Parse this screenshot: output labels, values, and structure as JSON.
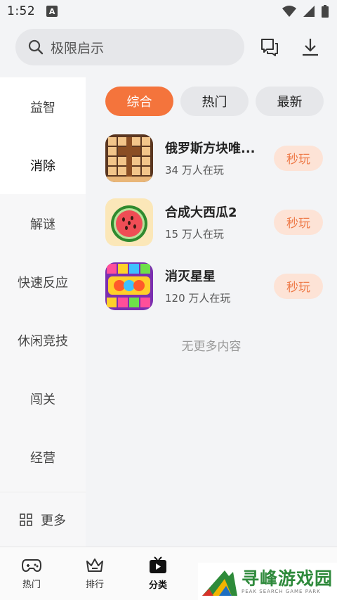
{
  "status_bar": {
    "time": "1:52",
    "notification_letter": "A"
  },
  "search": {
    "placeholder": "极限启示"
  },
  "sidebar": {
    "items": [
      {
        "label": "益智"
      },
      {
        "label": "消除"
      },
      {
        "label": "解谜"
      },
      {
        "label": "快速反应"
      },
      {
        "label": "休闲竞技"
      },
      {
        "label": "闯关"
      },
      {
        "label": "经营"
      }
    ],
    "active_index": 1,
    "more_label": "更多"
  },
  "filters": [
    {
      "label": "综合",
      "active": true
    },
    {
      "label": "热门",
      "active": false
    },
    {
      "label": "最新",
      "active": false
    }
  ],
  "games": [
    {
      "name": "俄罗斯方块唯...",
      "players": "34 万人在玩",
      "play_label": "秒玩",
      "icon": "wood-block-puzzle-icon"
    },
    {
      "name": "合成大西瓜2",
      "players": "15 万人在玩",
      "play_label": "秒玩",
      "icon": "watermelon-icon"
    },
    {
      "name": "消灭星星",
      "players": "120 万人在玩",
      "play_label": "秒玩",
      "icon": "pop-star-icon"
    }
  ],
  "no_more": "无更多内容",
  "bottom_nav": [
    {
      "label": "热门",
      "icon": "gamepad-icon"
    },
    {
      "label": "排行",
      "icon": "crown-icon"
    },
    {
      "label": "分类",
      "icon": "tv-play-icon",
      "active": true
    }
  ],
  "watermark": {
    "title": "寻峰游戏园",
    "subtitle": "PEAK SEARCH GAME PARK"
  },
  "colors": {
    "accent": "#f4743c",
    "play_bg": "#fde3d6",
    "play_text": "#ee7a48"
  }
}
